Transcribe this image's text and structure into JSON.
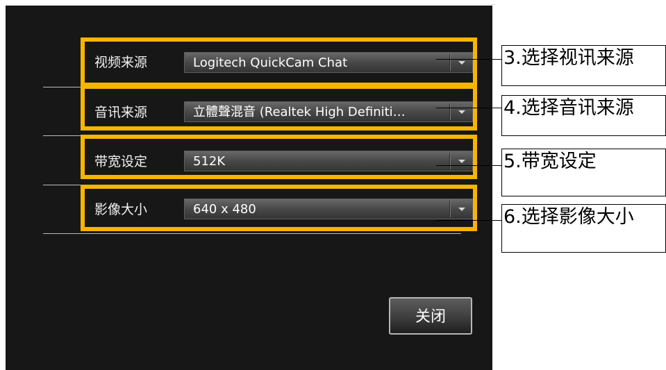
{
  "settings": {
    "rows": [
      {
        "label": "视频来源",
        "value": "Logitech QuickCam Chat"
      },
      {
        "label": "音讯来源",
        "value": "立體聲混音 (Realtek High Definiti…"
      },
      {
        "label": "带宽设定",
        "value": "512K"
      },
      {
        "label": "影像大小",
        "value": "640 x 480"
      }
    ],
    "close_label": "关闭"
  },
  "annotations": [
    "3.选择视讯来源",
    "4.选择音讯来源",
    "5.带宽设定",
    "6.选择影像大小"
  ],
  "colors": {
    "panel_background": "#171717",
    "highlight": "#f7b500",
    "select_gradient_top": "#686868",
    "select_gradient_bottom": "#353535",
    "text_light": "#f2f2f2"
  },
  "icons": {
    "dropdown": "chevron-down-icon"
  }
}
